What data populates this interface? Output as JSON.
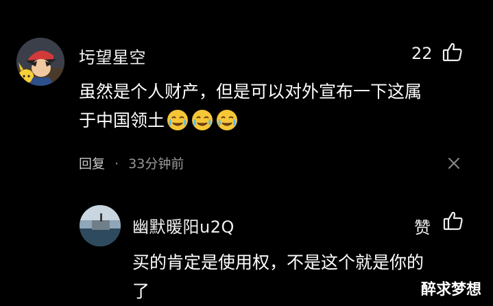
{
  "comment": {
    "username": "圬望星空",
    "likes": "22",
    "text": "虽然是个人财产，但是可以对外宣布一下这属于中国领土",
    "line1": "虽然是个人财产，但是可以对外宣布一下这属",
    "line2": "于中国领土",
    "emojis": [
      "crying-laughing-emoji",
      "crying-laughing-emoji",
      "crying-laughing-emoji"
    ],
    "reply_label": "回复",
    "separator": "·",
    "time": "33分钟前",
    "close_icon": "close-icon"
  },
  "reply": {
    "username": "幽默暖阳u2Q",
    "like_label": "赞",
    "line1": "买的肯定是使用权，不是这个就是你的",
    "line2": "了"
  },
  "watermark": "醉求梦想"
}
